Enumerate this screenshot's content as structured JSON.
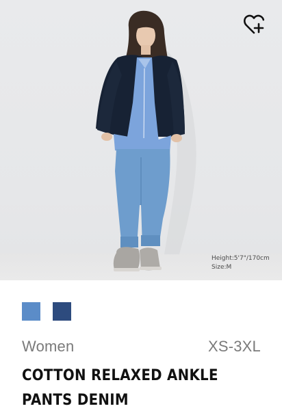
{
  "product": {
    "model_height": "Height:5'7\"/170cm",
    "model_size": "Size:M",
    "colors": [
      {
        "hex": "#5b8cc8"
      },
      {
        "hex": "#2d4b7e"
      }
    ],
    "gender": "Women",
    "size_range": "XS-3XL",
    "name": "COTTON RELAXED ANKLE PANTS DENIM"
  },
  "icons": {
    "wishlist": "heart-plus-icon"
  }
}
